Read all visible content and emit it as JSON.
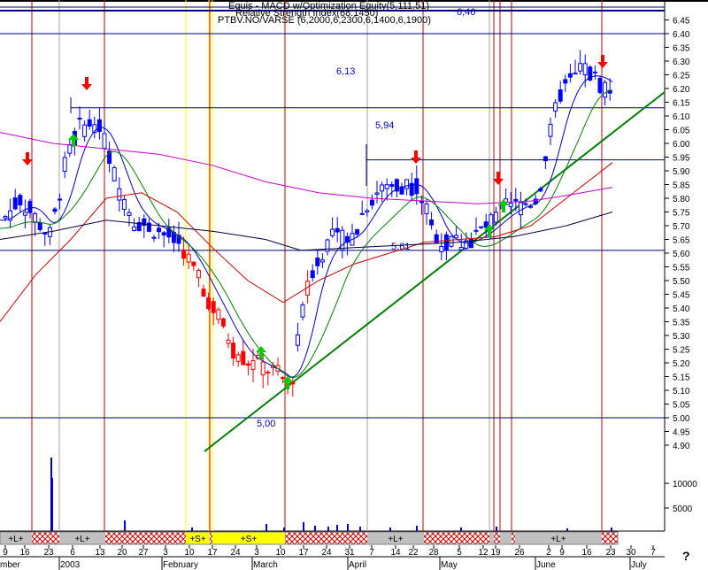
{
  "header": {
    "line1": "Equis - MACD w/Optimization Equity(5,111.51)",
    "line2": "Relative Strength Index(68.1450)",
    "line3": "PTBV.NO/VARSE (6,2000,6,2300,6,1400,6,1900)",
    "corner_value": "6,46"
  },
  "help_glyph": "?",
  "colors": {
    "up_candle": "#0000ff",
    "down_candle": "#ff0000",
    "ma_fast": "#0000c8",
    "ma_mid": "#008000",
    "ma_red": "#cc0000",
    "ma_magenta": "#c800c8",
    "ma_long": "#000040",
    "trendline": "#008000",
    "hline": "#000080",
    "vline_red": "#c00000",
    "vline_yellow": "#ffff00",
    "vline_gray": "#a0a0a0",
    "sell_arrow": "#ff0000",
    "buy_arrow": "#00cc00",
    "label_text": "#0000c8"
  },
  "chart_data": {
    "type": "candlestick",
    "y_axis": {
      "range": [
        4.86,
        6.5
      ],
      "ticks": [
        "6.45",
        "6.40",
        "6.35",
        "6.30",
        "6.25",
        "6.20",
        "6.15",
        "6.10",
        "6.05",
        "6.00",
        "5.95",
        "5.90",
        "5.85",
        "5.80",
        "5.75",
        "5.70",
        "5.65",
        "5.60",
        "5.55",
        "5.50",
        "5.45",
        "5.40",
        "5.35",
        "5.30",
        "5.25",
        "5.20",
        "5.15",
        "5.10",
        "5.05",
        "5.00",
        "4.95",
        "4.90"
      ]
    },
    "volume_axis": {
      "ticks": [
        "10000",
        "5000"
      ],
      "spike_note": "isolated volume spikes near early January"
    },
    "x_labels": [
      "9",
      "16",
      "23",
      "6",
      "13",
      "20",
      "27",
      "3",
      "10",
      "17",
      "24",
      "3",
      "10",
      "17",
      "24",
      "31",
      "7",
      "14",
      "22",
      "28",
      "5",
      "12",
      "19",
      "26",
      "2",
      "9",
      "16",
      "23",
      "30",
      "7"
    ],
    "month_labels": [
      "mber",
      "2003",
      "February",
      "March",
      "April",
      "May",
      "June",
      "July"
    ],
    "horizontal_levels": [
      {
        "value": 6.46,
        "label": "6,46"
      },
      {
        "value": 6.4,
        "label": ""
      },
      {
        "value": 6.13,
        "label": "6,13"
      },
      {
        "value": 5.94,
        "label": "5,94"
      },
      {
        "value": 5.61,
        "label": "5,61"
      },
      {
        "value": 5.0,
        "label": "5,00"
      }
    ],
    "trendlines": [
      {
        "from": [
          "Feb 17",
          4.97
        ],
        "to": [
          "July 4",
          6.15
        ]
      },
      {
        "from": [
          "Apr 30",
          5.61
        ],
        "to": [
          "July 4",
          6.15
        ]
      }
    ],
    "signal_bars": {
      "labels": [
        "+L+",
        "+L+",
        "+S+",
        "+S+",
        "+L+",
        "+L+"
      ]
    },
    "sample_closes": [
      5.8,
      5.78,
      5.72,
      6.05,
      6.07,
      5.92,
      5.72,
      5.66,
      5.6,
      5.5,
      5.38,
      5.22,
      5.14,
      5.18,
      5.35,
      5.58,
      5.65,
      5.82,
      5.85,
      5.7,
      5.66,
      5.7,
      5.76,
      5.78,
      5.92,
      6.18,
      6.25,
      6.19
    ]
  }
}
